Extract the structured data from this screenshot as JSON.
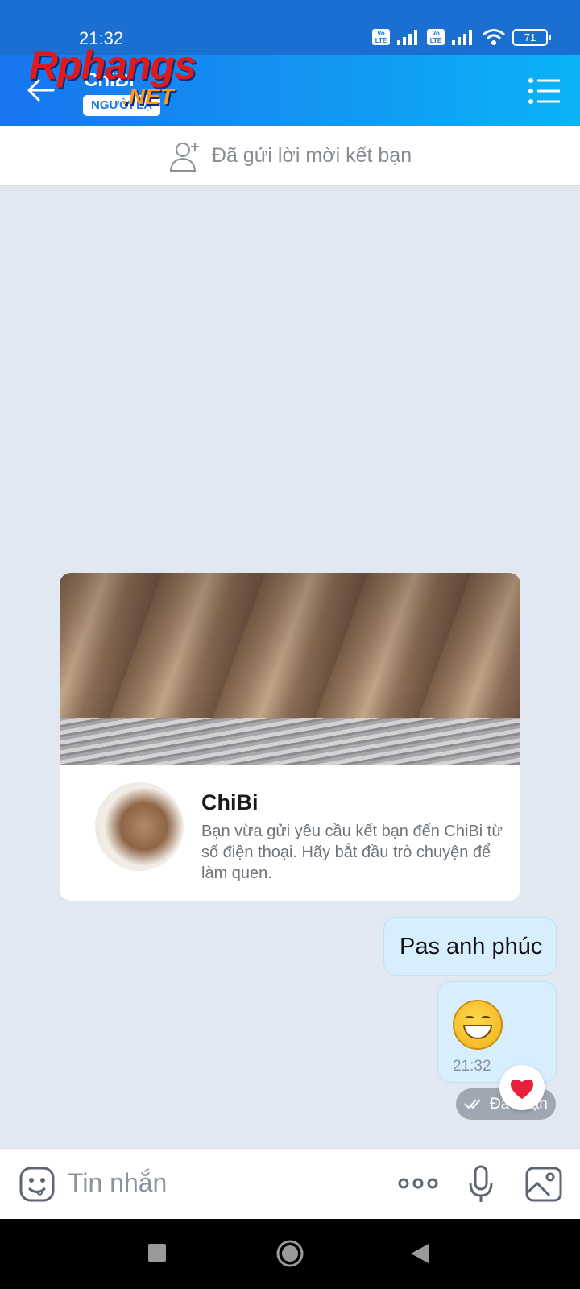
{
  "status_bar": {
    "time": "21:32",
    "battery": "71",
    "volte_label": "Vo LTE"
  },
  "header": {
    "title": "ChiBi",
    "badge": "NGƯỜI LẠ",
    "watermark_main": "Rphangs",
    "watermark_sub": ".NET"
  },
  "friend_request": {
    "label": "Đã gửi lời mời kết bạn",
    "icon": "add-user-icon"
  },
  "profile_card": {
    "name": "ChiBi",
    "description": "Bạn vừa gửi yêu cầu kết bạn đến ChiBi từ số điện thoại. Hãy bắt đầu trò chuyện để làm quen."
  },
  "messages": [
    {
      "text": "Pas anh phúc"
    },
    {
      "emoji": "grinning-face",
      "time": "21:32"
    }
  ],
  "delivery_status": "Đã nhận",
  "reaction": "heart",
  "input": {
    "placeholder": "Tin nhắn"
  },
  "nav": {
    "icons": [
      "recents-square",
      "home-circle",
      "back-triangle"
    ]
  },
  "colors": {
    "header_start": "#1775f0",
    "header_end": "#0ab3f6",
    "chat_bg": "#e2e8f1",
    "bubble": "#d6eefe"
  }
}
